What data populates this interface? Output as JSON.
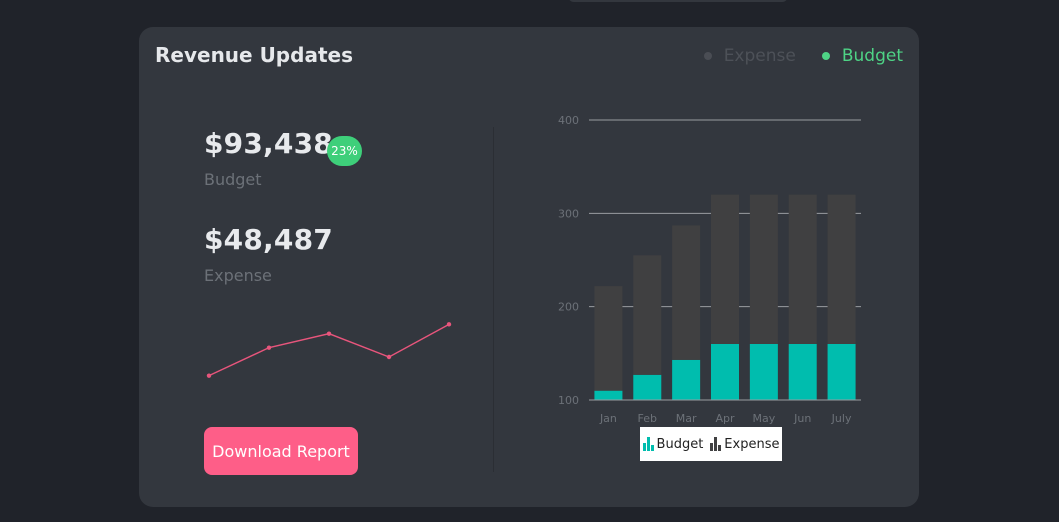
{
  "card": {
    "title": "Revenue Updates",
    "legend": [
      {
        "label": "Expense",
        "color": "#4a4d54"
      },
      {
        "label": "Budget",
        "color": "#4ed385"
      }
    ]
  },
  "summary": {
    "budget_value": "$93,438",
    "budget_label": "Budget",
    "budget_change": "23%",
    "expense_value": "$48,487",
    "expense_label": "Expense"
  },
  "sparkline": {
    "values": [
      10,
      40,
      55,
      30,
      65
    ],
    "color": "#e8557c"
  },
  "download_button": {
    "label": "Download Report",
    "color": "#fe5e88"
  },
  "chart_data": {
    "type": "bar",
    "stacked": true,
    "categories": [
      "Jan",
      "Feb",
      "Mar",
      "Apr",
      "May",
      "Jun",
      "July"
    ],
    "series": [
      {
        "name": "Budget",
        "color": "#00bdae",
        "values": [
          10,
          27,
          43,
          60,
          60,
          60,
          60
        ]
      },
      {
        "name": "Expense",
        "color": "#404041",
        "values": [
          112,
          128,
          144,
          160,
          160,
          160,
          160
        ]
      }
    ],
    "ylim": [
      100,
      400
    ],
    "yticks": [
      100,
      200,
      300,
      400
    ],
    "grid": true,
    "legend_position": "bottom"
  }
}
